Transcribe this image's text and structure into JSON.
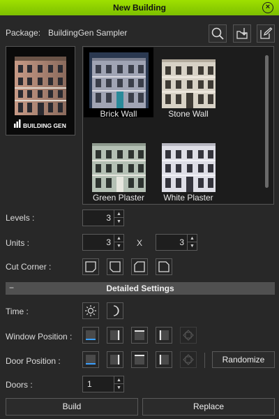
{
  "window": {
    "title": "New Building",
    "close_icon": "close-icon"
  },
  "package": {
    "label": "Package:",
    "name": "BuildingGen Sampler"
  },
  "toolbar": {
    "search_icon": "search-icon",
    "import_icon": "import-icon",
    "edit_icon": "edit-icon"
  },
  "preview": {
    "logo_text": "BUILDING GEN"
  },
  "gallery": {
    "items": [
      {
        "label": "Brick Wall",
        "selected": true,
        "wall": "#9aa0b0",
        "accent": "#8a6a60"
      },
      {
        "label": "Stone Wall",
        "selected": false,
        "wall": "#d6d0c6",
        "accent": "#b8a890"
      },
      {
        "label": "Green Plaster",
        "selected": false,
        "wall": "#b7c3b6",
        "accent": "#e4e4dc"
      },
      {
        "label": "White Plaster",
        "selected": false,
        "wall": "#dcdce4",
        "accent": "#f0f0f0"
      }
    ]
  },
  "levels": {
    "label": "Levels :",
    "value": "3"
  },
  "units": {
    "label": "Units :",
    "value_a": "3",
    "separator": "X",
    "value_b": "3"
  },
  "cut_corner": {
    "label": "Cut Corner :"
  },
  "detailed_settings": {
    "collapse": "−",
    "title": "Detailed Settings"
  },
  "time": {
    "label": "Time :",
    "day_icon": "sun-icon",
    "night_icon": "moon-icon"
  },
  "window_position": {
    "label": "Window Position :"
  },
  "door_position": {
    "label": "Door Position :"
  },
  "randomize": {
    "label": "Randomize"
  },
  "doors": {
    "label": "Doors :",
    "value": "1"
  },
  "actions": {
    "build": "Build",
    "replace": "Replace"
  },
  "colors": {
    "accent": "#8cd000",
    "selection": "#3aa0ff"
  }
}
